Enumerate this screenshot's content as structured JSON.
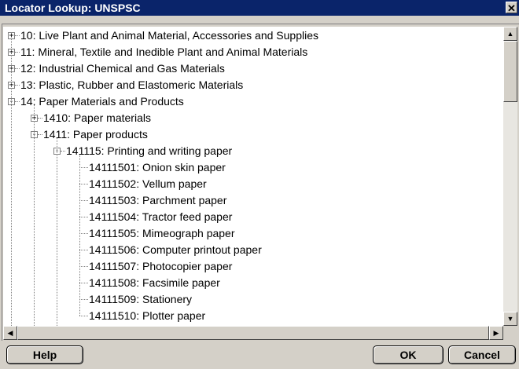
{
  "window": {
    "title": "Locator Lookup: UNSPSC",
    "close_label": "✕"
  },
  "tree": [
    {
      "depth": 0,
      "toggle": "+",
      "label": "10: Live Plant and Animal Material, Accessories and Supplies"
    },
    {
      "depth": 0,
      "toggle": "+",
      "label": "11: Mineral, Textile and Inedible Plant and Animal Materials"
    },
    {
      "depth": 0,
      "toggle": "+",
      "label": "12: Industrial Chemical and Gas Materials"
    },
    {
      "depth": 0,
      "toggle": "+",
      "label": "13: Plastic, Rubber and Elastomeric Materials"
    },
    {
      "depth": 0,
      "toggle": "-",
      "label": "14: Paper Materials and Products"
    },
    {
      "depth": 1,
      "toggle": "+",
      "label": "1410: Paper materials"
    },
    {
      "depth": 1,
      "toggle": "-",
      "label": "1411: Paper products"
    },
    {
      "depth": 2,
      "toggle": "-",
      "label": "141115: Printing and writing paper"
    },
    {
      "depth": 3,
      "toggle": "",
      "label": "14111501: Onion skin paper"
    },
    {
      "depth": 3,
      "toggle": "",
      "label": "14111502: Vellum paper"
    },
    {
      "depth": 3,
      "toggle": "",
      "label": "14111503: Parchment paper"
    },
    {
      "depth": 3,
      "toggle": "",
      "label": "14111504: Tractor feed paper"
    },
    {
      "depth": 3,
      "toggle": "",
      "label": "14111505: Mimeograph paper"
    },
    {
      "depth": 3,
      "toggle": "",
      "label": "14111506: Computer printout paper"
    },
    {
      "depth": 3,
      "toggle": "",
      "label": "14111507: Photocopier paper"
    },
    {
      "depth": 3,
      "toggle": "",
      "label": "14111508: Facsimile paper"
    },
    {
      "depth": 3,
      "toggle": "",
      "label": "14111509: Stationery"
    },
    {
      "depth": 3,
      "toggle": "",
      "label": "14111510: Plotter paper"
    }
  ],
  "scroll": {
    "up_arrow": "▲",
    "down_arrow": "▼",
    "left_arrow": "◀",
    "right_arrow": "▶"
  },
  "buttons": {
    "help_label": "Help",
    "ok_label": "OK",
    "cancel_label": "Cancel"
  }
}
